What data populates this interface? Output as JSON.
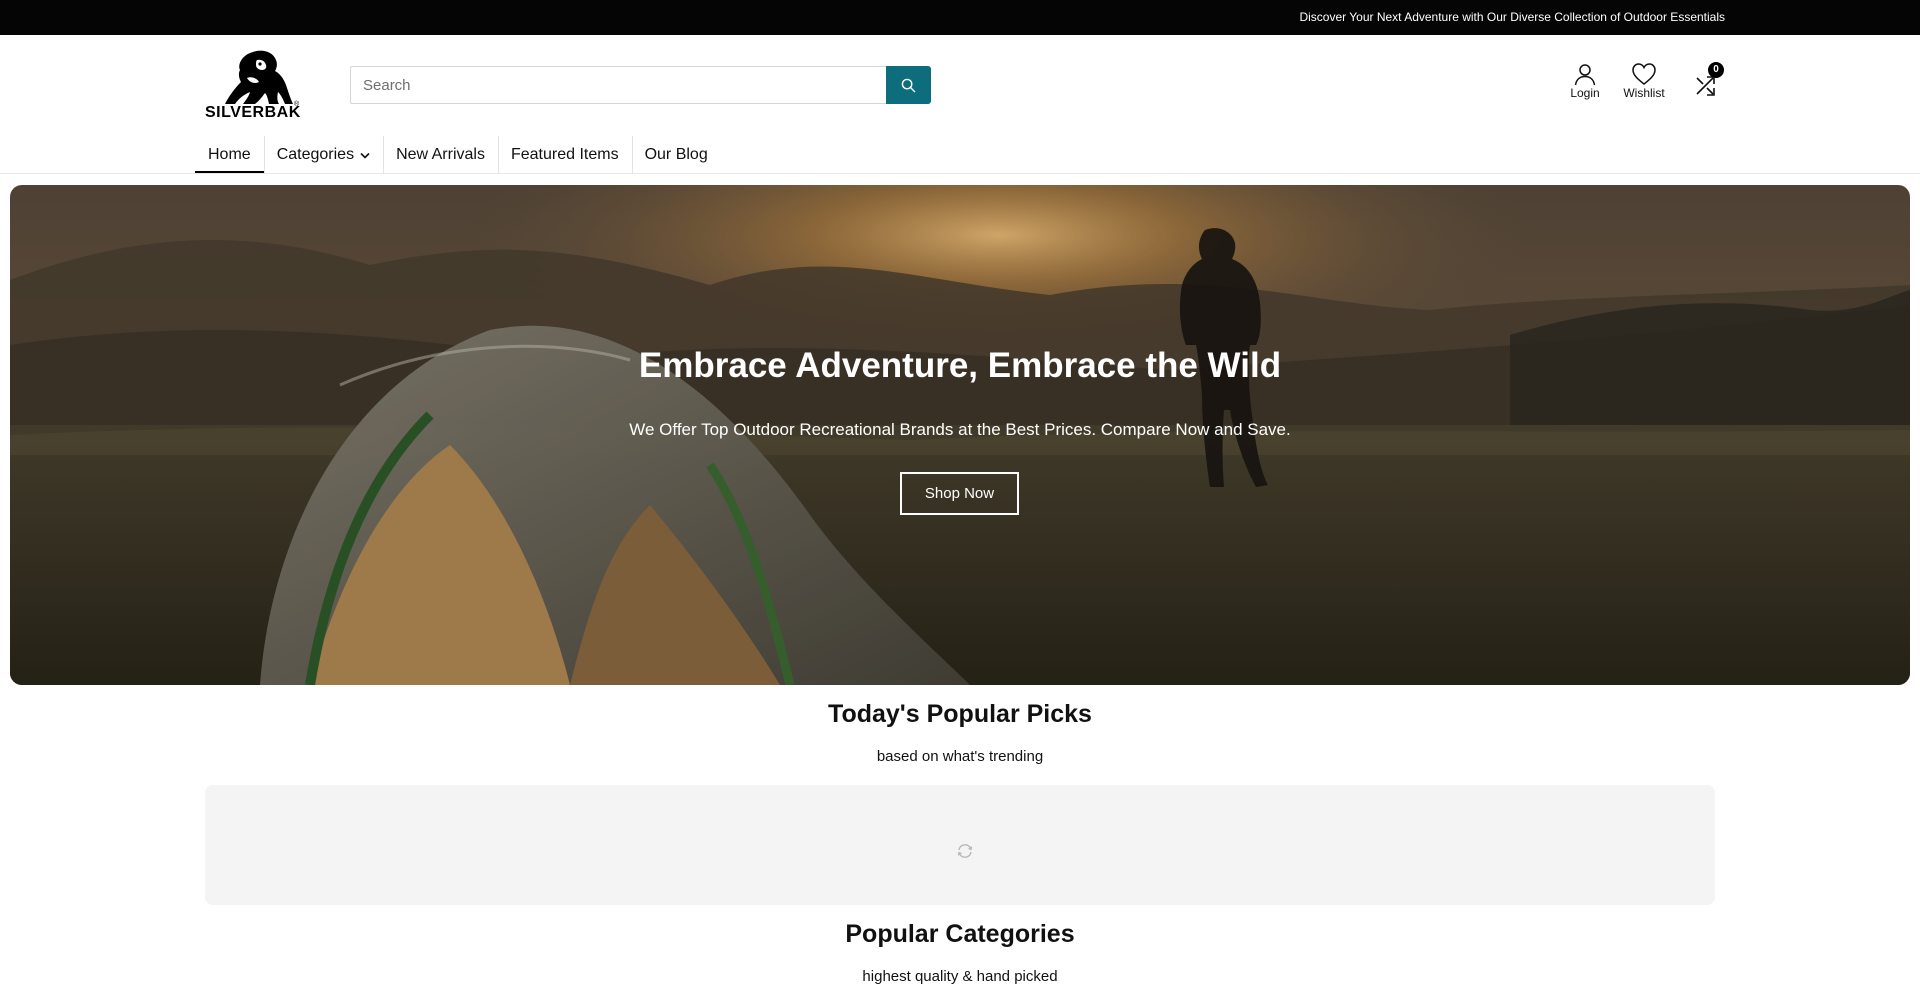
{
  "announcement": {
    "text": "Discover Your Next Adventure with Our Diverse Collection of Outdoor Essentials"
  },
  "brand": {
    "logo_text": "SILVERBAK",
    "logo_mark": "®"
  },
  "search": {
    "placeholder": "Search",
    "value": "",
    "button_icon": "search-icon"
  },
  "header_actions": [
    {
      "label": "Login",
      "icon": "user-icon"
    },
    {
      "label": "Wishlist",
      "icon": "heart-icon"
    },
    {
      "label": "",
      "icon": "compare-icon",
      "count": "0"
    }
  ],
  "nav": {
    "items": [
      {
        "label": "Home",
        "active": true
      },
      {
        "label": "Categories",
        "dropdown": true
      },
      {
        "label": "New Arrivals"
      },
      {
        "label": "Featured Items"
      },
      {
        "label": "Our Blog"
      }
    ]
  },
  "hero": {
    "title": "Embrace Adventure, Embrace the Wild",
    "subtitle": "We Offer Top Outdoor Recreational Brands at the Best Prices. Compare Now and Save.",
    "cta": "Shop Now"
  },
  "popular_picks": {
    "title": "Today's Popular Picks",
    "subtitle": "based on what's trending",
    "loading_icon": "refresh-icon"
  },
  "popular_categories": {
    "title": "Popular Categories",
    "subtitle": "highest quality & hand picked"
  },
  "colors": {
    "accent": "#0d6d7d",
    "announce_bg": "#050505",
    "loading_bg": "#f4f4f4"
  }
}
